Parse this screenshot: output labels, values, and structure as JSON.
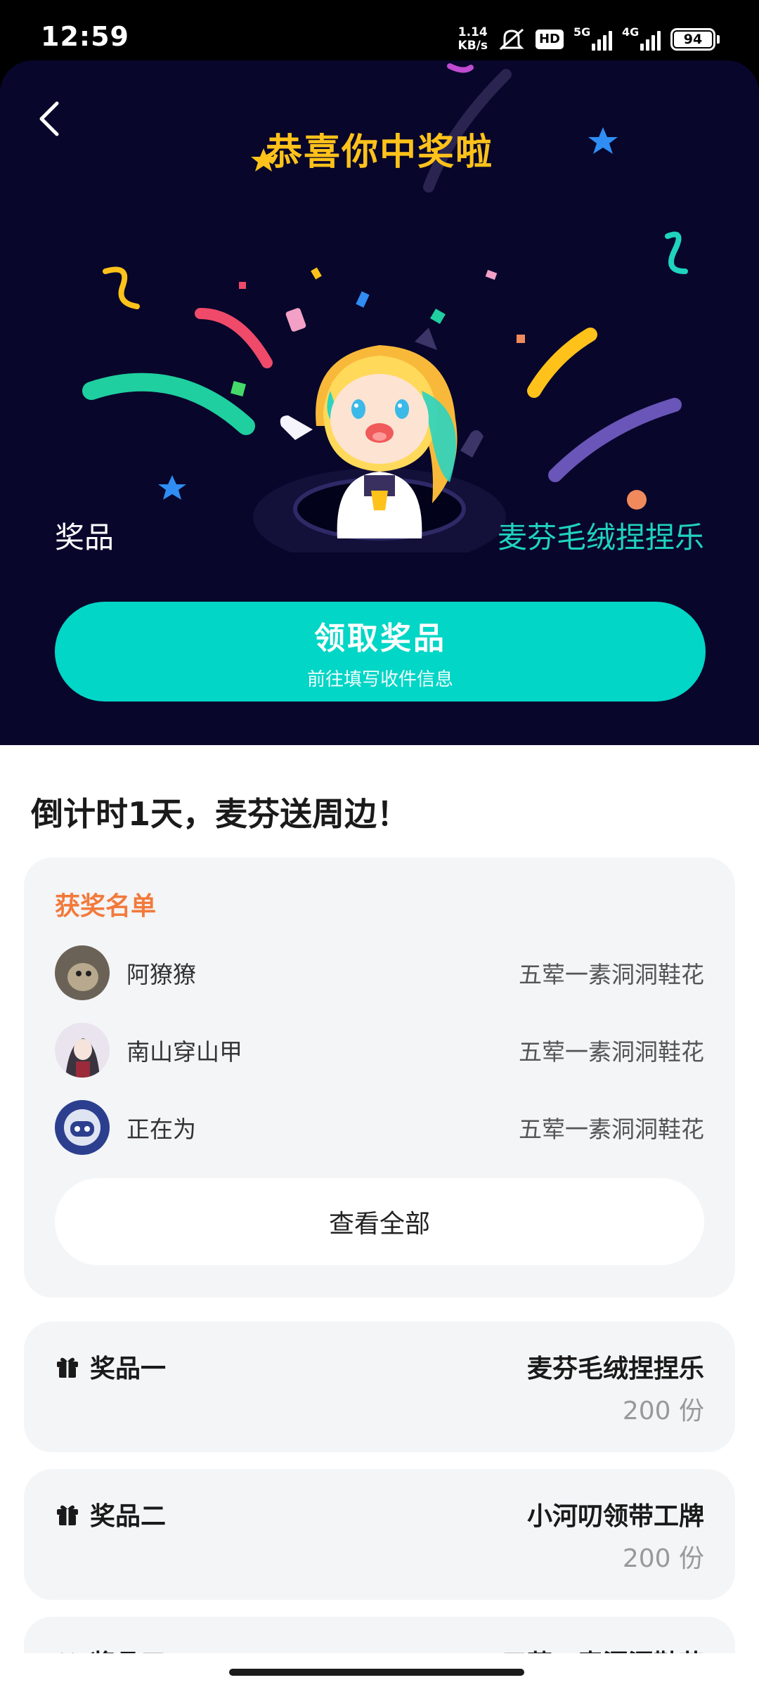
{
  "status": {
    "time": "12:59",
    "speed_value": "1.14",
    "speed_unit": "KB/s",
    "hd_label": "HD",
    "sig1_label": "5G",
    "sig2_label": "4G",
    "battery": "94"
  },
  "hero": {
    "title": "恭喜你中奖啦",
    "prize_label": "奖品",
    "prize_name": "麦芬毛绒捏捏乐",
    "claim_button": "领取奖品",
    "claim_sub": "前往填写收件信息"
  },
  "section_title": "倒计时1天，麦芬送周边！",
  "winners": {
    "title": "获奖名单",
    "rows": [
      {
        "name": "阿獠獠",
        "prize": "五荤一素洞洞鞋花"
      },
      {
        "name": "南山穿山甲",
        "prize": "五荤一素洞洞鞋花"
      },
      {
        "name": "正在为",
        "prize": "五荤一素洞洞鞋花"
      }
    ],
    "view_all": "查看全部"
  },
  "prizes": [
    {
      "label": "奖品一",
      "name": "麦芬毛绒捏捏乐",
      "count": "200 份"
    },
    {
      "label": "奖品二",
      "name": "小河叨领带工牌",
      "count": "200 份"
    },
    {
      "label": "奖品三",
      "name": "五荤一素洞洞鞋花",
      "count": ""
    }
  ],
  "colors": {
    "hero_bg": "#08062b",
    "title_gold": "#ffc21a",
    "accent_teal": "#02d6c6",
    "winners_orange": "#f27a3c",
    "card_bg": "#f4f5f7"
  },
  "icons": {
    "back": "chevron-left-icon",
    "gift": "gift-icon"
  }
}
